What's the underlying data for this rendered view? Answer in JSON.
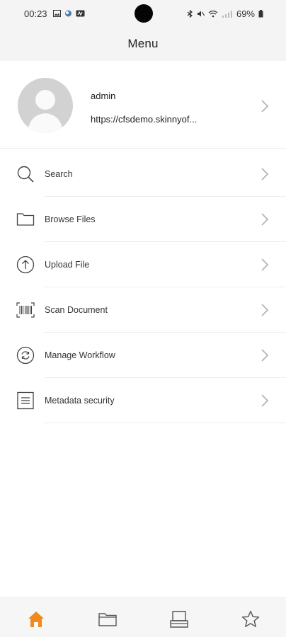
{
  "status_bar": {
    "time": "00:23",
    "battery": "69%"
  },
  "header": {
    "title": "Menu"
  },
  "profile": {
    "username": "admin",
    "server_url": "https://cfsdemo.skinnyof..."
  },
  "menu": {
    "items": [
      {
        "label": "Search",
        "icon": "search-icon"
      },
      {
        "label": "Browse Files",
        "icon": "folder-icon"
      },
      {
        "label": "Upload File",
        "icon": "upload-icon"
      },
      {
        "label": "Scan Document",
        "icon": "barcode-scan-icon"
      },
      {
        "label": "Manage Workflow",
        "icon": "workflow-sync-icon"
      },
      {
        "label": "Metadata security",
        "icon": "document-list-icon"
      }
    ]
  },
  "bottom_nav": {
    "items": [
      {
        "name": "home",
        "icon": "home-icon",
        "active": true
      },
      {
        "name": "files",
        "icon": "folder-icon",
        "active": false
      },
      {
        "name": "inbox",
        "icon": "inbox-tray-icon",
        "active": false
      },
      {
        "name": "favorites",
        "icon": "star-icon",
        "active": false
      }
    ]
  },
  "colors": {
    "accent": "#f08a1c",
    "chevron": "#b5b5b5",
    "icon_stroke": "#444444",
    "inactive_nav": "#555555",
    "header_bg": "#f4f4f4"
  }
}
